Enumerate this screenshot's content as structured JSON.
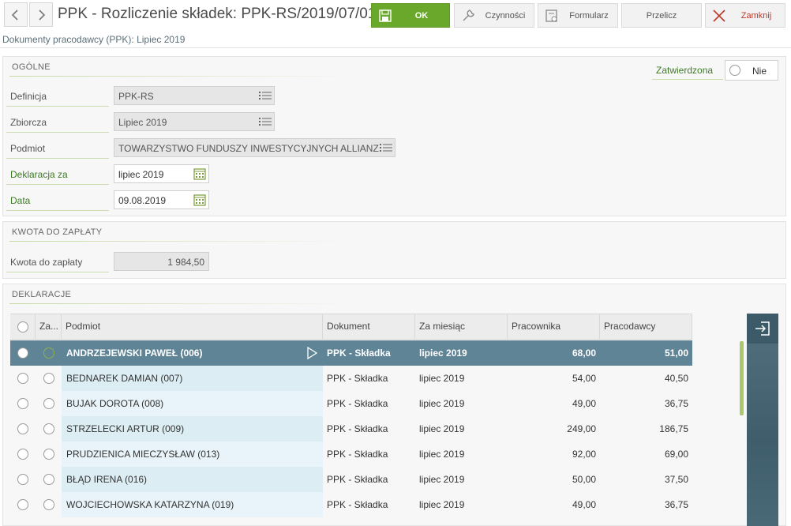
{
  "window": {
    "title": "PPK - Rozliczenie składek: PPK-RS/2019/07/01",
    "subtitle": "Dokumenty pracodawcy (PPK): Lipiec 2019"
  },
  "toolbar": {
    "ok_label": "OK",
    "czynnosci_label": "Czynności",
    "formularz_label": "Formularz",
    "przelicz_label": "Przelicz",
    "zamknij_label": "Zamknij"
  },
  "ogolne": {
    "section_title": "OGÓLNE",
    "zatwierdzona_label": "Zatwierdzona",
    "zatwierdzona_value": "Nie",
    "definicja_label": "Definicja",
    "definicja_value": "PPK-RS",
    "zbiorcza_label": "Zbiorcza",
    "zbiorcza_value": "Lipiec 2019",
    "podmiot_label": "Podmiot",
    "podmiot_value": "TOWARZYSTWO FUNDUSZY INWESTYCYJNYCH ALLIANZ",
    "deklaracja_label": "Deklaracja za",
    "deklaracja_value": "lipiec 2019",
    "data_label": "Data",
    "data_value": "09.08.2019"
  },
  "kwota": {
    "section_title": "KWOTA DO ZAPŁATY",
    "label": "Kwota do zapłaty",
    "value": "1 984,50"
  },
  "deklaracje": {
    "section_title": "DEKLARACJE",
    "columns": {
      "za": "Za...",
      "podmiot": "Podmiot",
      "dokument": "Dokument",
      "za_miesiac": "Za miesiąc",
      "pracownika": "Pracownika",
      "pracodawcy": "Pracodawcy"
    },
    "rows": [
      {
        "podmiot": "ANDRZEJEWSKI PAWEŁ (006)",
        "dokument": "PPK - Składka",
        "za_miesiac": "lipiec 2019",
        "pracownika": "68,00",
        "pracodawcy": "51,00"
      },
      {
        "podmiot": "BEDNAREK DAMIAN (007)",
        "dokument": "PPK - Składka",
        "za_miesiac": "lipiec 2019",
        "pracownika": "54,00",
        "pracodawcy": "40,50"
      },
      {
        "podmiot": "BUJAK DOROTA (008)",
        "dokument": "PPK - Składka",
        "za_miesiac": "lipiec 2019",
        "pracownika": "49,00",
        "pracodawcy": "36,75"
      },
      {
        "podmiot": "STRZELECKI ARTUR (009)",
        "dokument": "PPK - Składka",
        "za_miesiac": "lipiec 2019",
        "pracownika": "249,00",
        "pracodawcy": "186,75"
      },
      {
        "podmiot": "PRUDZIENICA MIECZYSŁAW (013)",
        "dokument": "PPK - Składka",
        "za_miesiac": "lipiec 2019",
        "pracownika": "92,00",
        "pracodawcy": "69,00"
      },
      {
        "podmiot": "BŁĄD IRENA (016)",
        "dokument": "PPK - Składka",
        "za_miesiac": "lipiec 2019",
        "pracownika": "50,00",
        "pracodawcy": "37,50"
      },
      {
        "podmiot": "WOJCIECHOWSKA KATARZYNA (019)",
        "dokument": "PPK - Składka",
        "za_miesiac": "lipiec 2019",
        "pracownika": "49,00",
        "pracodawcy": "36,75"
      }
    ]
  },
  "colors": {
    "accent_green": "#6aa82b",
    "selected_row": "#5f8496",
    "close_red": "#c0392b",
    "side_panel": "#4a6976"
  }
}
